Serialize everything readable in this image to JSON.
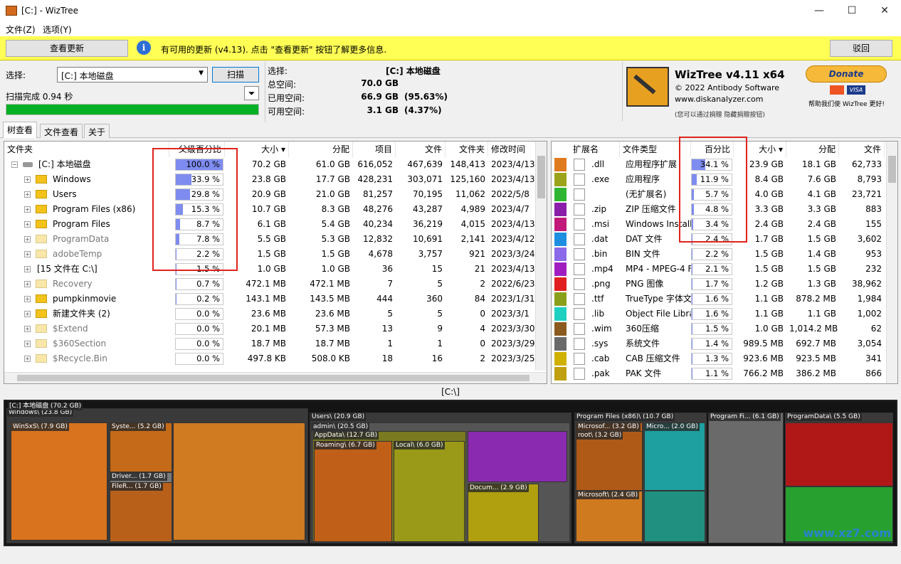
{
  "window": {
    "title": "[C:]  - WizTree",
    "min": "—",
    "max": "☐",
    "close": "✕"
  },
  "menu": [
    "文件(Z)",
    "选项(Y)"
  ],
  "update": {
    "check_btn": "查看更新",
    "message": "有可用的更新 (v4.13). 点击 \"查看更新\" 按钮了解更多信息.",
    "dismiss_btn": "驳回"
  },
  "scan": {
    "select_label": "选择:",
    "drive": "[C:] 本地磁盘",
    "scan_btn": "扫描",
    "status": "扫描完成 0.94 秒",
    "progress": 1.0
  },
  "driveinfo": {
    "l1": "选择:",
    "v1": "[C:]  本地磁盘",
    "l2": "总空间:",
    "v2": "70.0 GB",
    "l3": "已用空间:",
    "v3": "66.9 GB",
    "p3": "(95.63%)",
    "l4": "可用空间:",
    "v4": "3.1 GB",
    "p4": "(4.37%)"
  },
  "logo": {
    "name": "WizTree v4.11 x64",
    "copy": "© 2022 Antibody Software",
    "url": "www.diskanalyzer.com",
    "note": "(您可以通过捐赠 隐藏捐赠按钮)",
    "donate": "Donate",
    "help": "帮助我们使 WizTree 更好!"
  },
  "tabs": [
    "树查看",
    "文件查看",
    "关于"
  ],
  "tree": {
    "headers": [
      "文件夹",
      "父级百分比",
      "大小",
      "分配",
      "项目",
      "文件",
      "文件夹",
      "修改时间"
    ],
    "rows": [
      {
        "name": "[C:] 本地磁盘",
        "pct": "100.0 %",
        "p": 1.0,
        "size": "70.2 GB",
        "alloc": "61.0 GB",
        "items": "616,052",
        "files": "467,639",
        "folders": "148,413",
        "mod": "2023/4/13",
        "lvl": 0,
        "kind": "drive"
      },
      {
        "name": "Windows",
        "pct": "33.9 %",
        "p": 0.339,
        "size": "23.8 GB",
        "alloc": "17.7 GB",
        "items": "428,231",
        "files": "303,071",
        "folders": "125,160",
        "mod": "2023/4/13",
        "lvl": 1,
        "kind": "folder"
      },
      {
        "name": "Users",
        "pct": "29.8 %",
        "p": 0.298,
        "size": "20.9 GB",
        "alloc": "21.0 GB",
        "items": "81,257",
        "files": "70,195",
        "folders": "11,062",
        "mod": "2022/5/8",
        "lvl": 1,
        "kind": "folder"
      },
      {
        "name": "Program Files (x86)",
        "pct": "15.3 %",
        "p": 0.153,
        "size": "10.7 GB",
        "alloc": "8.3 GB",
        "items": "48,276",
        "files": "43,287",
        "folders": "4,989",
        "mod": "2023/4/7",
        "lvl": 1,
        "kind": "folder"
      },
      {
        "name": "Program Files",
        "pct": "8.7 %",
        "p": 0.087,
        "size": "6.1 GB",
        "alloc": "5.4 GB",
        "items": "40,234",
        "files": "36,219",
        "folders": "4,015",
        "mod": "2023/4/13",
        "lvl": 1,
        "kind": "folder"
      },
      {
        "name": "ProgramData",
        "pct": "7.8 %",
        "p": 0.078,
        "size": "5.5 GB",
        "alloc": "5.3 GB",
        "items": "12,832",
        "files": "10,691",
        "folders": "2,141",
        "mod": "2023/4/12",
        "lvl": 1,
        "kind": "gray"
      },
      {
        "name": "adobeTemp",
        "pct": "2.2 %",
        "p": 0.022,
        "size": "1.5 GB",
        "alloc": "1.5 GB",
        "items": "4,678",
        "files": "3,757",
        "folders": "921",
        "mod": "2023/3/24",
        "lvl": 1,
        "kind": "gray"
      },
      {
        "name": "[15 文件在 C:\\]",
        "pct": "1.5 %",
        "p": 0.015,
        "size": "1.0 GB",
        "alloc": "1.0 GB",
        "items": "36",
        "files": "15",
        "folders": "21",
        "mod": "2023/4/13",
        "lvl": 1,
        "kind": "none"
      },
      {
        "name": "Recovery",
        "pct": "0.7 %",
        "p": 0.007,
        "size": "472.1 MB",
        "alloc": "472.1 MB",
        "items": "7",
        "files": "5",
        "folders": "2",
        "mod": "2022/6/23",
        "lvl": 1,
        "kind": "sys"
      },
      {
        "name": "pumpkinmovie",
        "pct": "0.2 %",
        "p": 0.002,
        "size": "143.1 MB",
        "alloc": "143.5 MB",
        "items": "444",
        "files": "360",
        "folders": "84",
        "mod": "2023/1/31",
        "lvl": 1,
        "kind": "folder"
      },
      {
        "name": "新建文件夹 (2)",
        "pct": "0.0 %",
        "p": 0,
        "size": "23.6 MB",
        "alloc": "23.6 MB",
        "items": "5",
        "files": "5",
        "folders": "0",
        "mod": "2023/3/1",
        "lvl": 1,
        "kind": "folder"
      },
      {
        "name": "$Extend",
        "pct": "0.0 %",
        "p": 0,
        "size": "20.1 MB",
        "alloc": "57.3 MB",
        "items": "13",
        "files": "9",
        "folders": "4",
        "mod": "2023/3/30",
        "lvl": 1,
        "kind": "sys"
      },
      {
        "name": "$360Section",
        "pct": "0.0 %",
        "p": 0,
        "size": "18.7 MB",
        "alloc": "18.7 MB",
        "items": "1",
        "files": "1",
        "folders": "0",
        "mod": "2023/3/29",
        "lvl": 1,
        "kind": "sys"
      },
      {
        "name": "$Recycle.Bin",
        "pct": "0.0 %",
        "p": 0,
        "size": "497.8 KB",
        "alloc": "508.0 KB",
        "items": "18",
        "files": "16",
        "folders": "2",
        "mod": "2023/3/25",
        "lvl": 1,
        "kind": "sys"
      }
    ]
  },
  "ext": {
    "headers": [
      "扩展名",
      "文件类型",
      "百分比",
      "大小",
      "分配",
      "文件"
    ],
    "rows": [
      {
        "ext": ".dll",
        "type": "应用程序扩展",
        "pct": "34.1 %",
        "p": 0.341,
        "size": "23.9 GB",
        "alloc": "18.1 GB",
        "files": "62,733",
        "color": "#e07a1f"
      },
      {
        "ext": ".exe",
        "type": "应用程序",
        "pct": "11.9 %",
        "p": 0.119,
        "size": "8.4 GB",
        "alloc": "7.6 GB",
        "files": "8,793",
        "color": "#9aa31a"
      },
      {
        "ext": "",
        "type": "(无扩展名)",
        "pct": "5.7 %",
        "p": 0.057,
        "size": "4.0 GB",
        "alloc": "4.1 GB",
        "files": "23,721",
        "color": "#2fb52f"
      },
      {
        "ext": ".zip",
        "type": "ZIP 压缩文件",
        "pct": "4.8 %",
        "p": 0.048,
        "size": "3.3 GB",
        "alloc": "3.3 GB",
        "files": "883",
        "color": "#8a1ea8"
      },
      {
        "ext": ".msi",
        "type": "Windows Installer",
        "pct": "3.4 %",
        "p": 0.034,
        "size": "2.4 GB",
        "alloc": "2.4 GB",
        "files": "155",
        "color": "#c0197a"
      },
      {
        "ext": ".dat",
        "type": "DAT 文件",
        "pct": "2.4 %",
        "p": 0.024,
        "size": "1.7 GB",
        "alloc": "1.5 GB",
        "files": "3,602",
        "color": "#1e8fe0"
      },
      {
        "ext": ".bin",
        "type": "BIN 文件",
        "pct": "2.2 %",
        "p": 0.022,
        "size": "1.5 GB",
        "alloc": "1.4 GB",
        "files": "953",
        "color": "#8a6ae8"
      },
      {
        "ext": ".mp4",
        "type": "MP4 - MPEG-4 F",
        "pct": "2.1 %",
        "p": 0.021,
        "size": "1.5 GB",
        "alloc": "1.5 GB",
        "files": "232",
        "color": "#a01ec0"
      },
      {
        "ext": ".png",
        "type": "PNG 图像",
        "pct": "1.7 %",
        "p": 0.017,
        "size": "1.2 GB",
        "alloc": "1.3 GB",
        "files": "38,962",
        "color": "#e02020"
      },
      {
        "ext": ".ttf",
        "type": "TrueType 字体文",
        "pct": "1.6 %",
        "p": 0.016,
        "size": "1.1 GB",
        "alloc": "878.2 MB",
        "files": "1,984",
        "color": "#8aa01a"
      },
      {
        "ext": ".lib",
        "type": "Object File Libra",
        "pct": "1.6 %",
        "p": 0.016,
        "size": "1.1 GB",
        "alloc": "1.1 GB",
        "files": "1,002",
        "color": "#1ed0c0"
      },
      {
        "ext": ".wim",
        "type": "360压缩",
        "pct": "1.5 %",
        "p": 0.015,
        "size": "1.0 GB",
        "alloc": "1,014.2 MB",
        "files": "62",
        "color": "#8a5a1e"
      },
      {
        "ext": ".sys",
        "type": "系统文件",
        "pct": "1.4 %",
        "p": 0.014,
        "size": "989.5 MB",
        "alloc": "692.7 MB",
        "files": "3,054",
        "color": "#6a6a6a"
      },
      {
        "ext": ".cab",
        "type": "CAB 压缩文件",
        "pct": "1.3 %",
        "p": 0.013,
        "size": "923.6 MB",
        "alloc": "923.5 MB",
        "files": "341",
        "color": "#d0b000"
      },
      {
        "ext": ".pak",
        "type": "PAK 文件",
        "pct": "1.1 %",
        "p": 0.011,
        "size": "766.2 MB",
        "alloc": "386.2 MB",
        "files": "866",
        "color": "#c0a010"
      }
    ]
  },
  "path": "[C:\\]",
  "treemap": {
    "root": "[C:] 本地磁盘 (70.2 GB)",
    "labels": [
      "Windows\\ (23.8 GB)",
      "WinSxS\\ (7.9 GB)",
      "Syste... (5.2 GB)",
      "Driver... (1.7 GB)",
      "FileR... (1.7 GB)",
      "Users\\ (20.9 GB)",
      "admin\\ (20.5 GB)",
      "AppData\\ (12.7 GB)",
      "Roaming\\ (6.7 GB)",
      "Local\\ (6.0 GB)",
      "Docum... (2.9 GB)",
      "Program Files (x86)\\ (10.7 GB)",
      "Microsof... (3.2 GB)",
      "root\\ (3.2 GB)",
      "Micro... (2.0 GB)",
      "Microsoft\\ (2.4 GB)",
      "Program Fi... (6.1 GB)",
      "ProgramData\\ (5.5 GB)"
    ]
  },
  "watermark": "www.xz7.com"
}
